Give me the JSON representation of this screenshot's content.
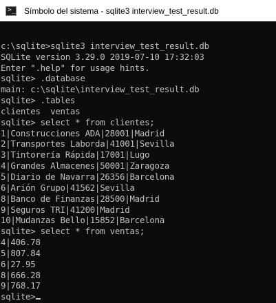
{
  "window": {
    "title": "Símbolo del sistema - sqlite3  interview_test_result.db",
    "icon": "command-prompt-icon",
    "icon_glyph": ">_"
  },
  "colors": {
    "terminal_background": "#0c0c0c",
    "terminal_text": "#c0c0c0",
    "titlebar_background": "#ffffff"
  },
  "terminal": {
    "blank_line": "",
    "command_open": "c:\\sqlite>sqlite3 interview_test_result.db",
    "version_info": "SQLite version 3.29.0 2019-07-10 17:32:03",
    "help_hint": "Enter \".help\" for usage hints.",
    "command_database": "sqlite> .database",
    "database_result": "main: c:\\sqlite\\interview_test_result.db",
    "command_tables": "sqlite> .tables",
    "tables_result": "clientes  ventas",
    "command_select_clientes": "sqlite> select * from clientes;",
    "clientes_rows": [
      "1|Construcciones ADA|28001|Madrid",
      "2|Transportes Laborda|41001|Sevilla",
      "3|Tintorería Rápida|17001|Lugo",
      "4|Grandes Almacenes|50001|Zaragoza",
      "5|Diario de Navarra|26356|Barcelona",
      "6|Arión Grupo|41562|Sevilla",
      "8|Banco de Finanzas|28500|Madrid",
      "9|Seguros TRI|41200|Madrid",
      "10|Mudanzas Bello|15852|Barcelona"
    ],
    "command_select_ventas": "sqlite> select * from ventas;",
    "ventas_rows": [
      "4|406.78",
      "5|807.84",
      "6|27.95",
      "8|666.28",
      "9|768.17"
    ],
    "current_prompt": "sqlite>"
  }
}
